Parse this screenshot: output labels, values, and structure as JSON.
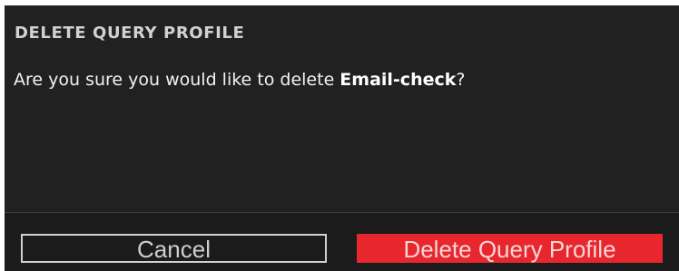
{
  "dialog": {
    "title": "DELETE QUERY PROFILE",
    "message_prefix": "Are you sure you would like to delete ",
    "item_name": "Email-check",
    "message_suffix": "?"
  },
  "buttons": {
    "cancel_label": "Cancel",
    "delete_label": "Delete Query Profile"
  },
  "colors": {
    "dialog_background": "#212121",
    "danger_accent": "#e8262e",
    "text_primary": "#f2f2f2"
  }
}
